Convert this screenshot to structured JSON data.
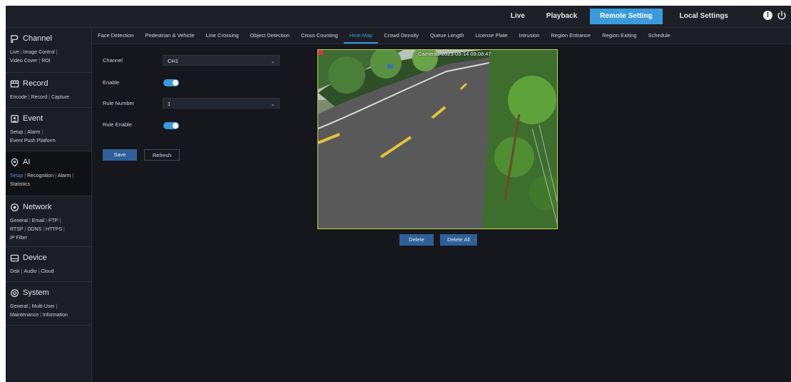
{
  "topnav": {
    "items": [
      {
        "label": "Live",
        "active": false
      },
      {
        "label": "Playback",
        "active": false
      },
      {
        "label": "Remote Setting",
        "active": true
      },
      {
        "label": "Local Settings",
        "active": false
      }
    ],
    "info_icon": "info-icon",
    "power_icon": "power-icon"
  },
  "sidebar": {
    "sections": [
      {
        "title": "Channel",
        "icon": "channel-icon",
        "links": [
          "Live",
          "Image Control",
          "Video Cover",
          "ROI"
        ]
      },
      {
        "title": "Record",
        "icon": "record-icon",
        "links": [
          "Encode",
          "Record",
          "Capture"
        ]
      },
      {
        "title": "Event",
        "icon": "event-icon",
        "links": [
          "Setup",
          "Alarm",
          "Event Push Platform"
        ]
      },
      {
        "title": "AI",
        "icon": "ai-icon",
        "links": [
          "Setup",
          "Recognition",
          "Alarm",
          "Statistics"
        ],
        "active": true,
        "selected_link": "Setup"
      },
      {
        "title": "Network",
        "icon": "network-icon",
        "links": [
          "General",
          "Email",
          "FTP",
          "RTSP",
          "DDNS",
          "HTTPS",
          "IP Filter"
        ]
      },
      {
        "title": "Device",
        "icon": "device-icon",
        "links": [
          "Disk",
          "Audio",
          "Cloud"
        ]
      },
      {
        "title": "System",
        "icon": "system-icon",
        "links": [
          "General",
          "Multi-User",
          "Maintenance",
          "Information"
        ]
      }
    ]
  },
  "tabs": [
    {
      "label": "Face Detection"
    },
    {
      "label": "Pedestrian & Vehicle"
    },
    {
      "label": "Line Crossing"
    },
    {
      "label": "Object Detection"
    },
    {
      "label": "Cross Counting"
    },
    {
      "label": "Heat Map",
      "active": true
    },
    {
      "label": "Crowd Density"
    },
    {
      "label": "Queue Length"
    },
    {
      "label": "License Plate"
    },
    {
      "label": "Intrusion"
    },
    {
      "label": "Region Entrance"
    },
    {
      "label": "Region Exiting"
    },
    {
      "label": "Schedule"
    }
  ],
  "form": {
    "channel_label": "Channel",
    "channel_value": "CH1",
    "enable_label": "Enable",
    "enable_on": true,
    "rule_number_label": "Rule Number",
    "rule_number_value": "1",
    "rule_enable_label": "Rule Enable",
    "rule_enable_on": true,
    "save_label": "Save",
    "refresh_label": "Refresh"
  },
  "video": {
    "overlay_text": "Camera1   2023-06-14 09:08:47"
  },
  "actions": {
    "delete_label": "Delete",
    "delete_all_label": "Delete All"
  },
  "colors": {
    "accent": "#3a9bdc",
    "button": "#2f5f97",
    "region_border": "#c6d64a"
  }
}
